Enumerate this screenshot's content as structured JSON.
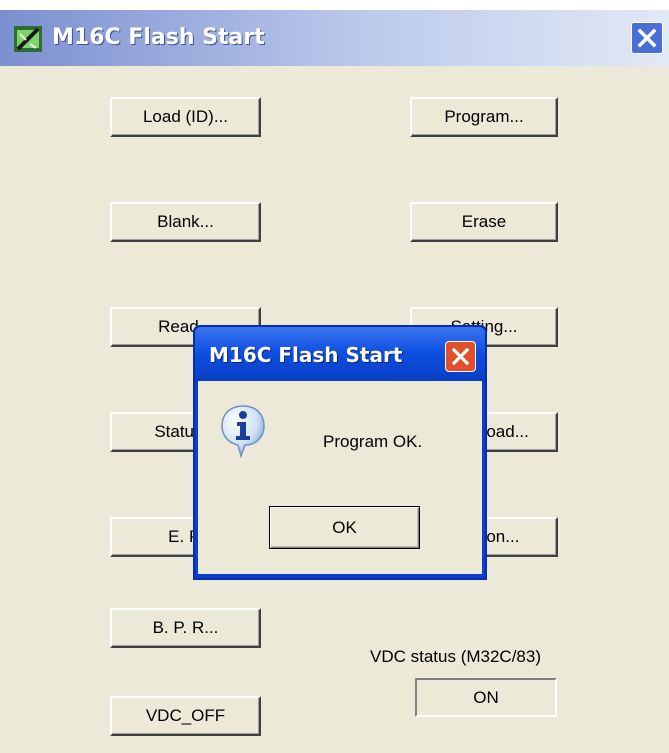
{
  "window": {
    "title": "M16C Flash Start"
  },
  "buttons": {
    "load_id": "Load (ID)...",
    "program": "Program...",
    "blank": "Blank...",
    "erase": "Erase",
    "read": "Read...",
    "setting": "Setting...",
    "status": "Status...",
    "download": "Download...",
    "ep": "E. P.",
    "version": "Version...",
    "bpr": "B. P. R...",
    "vdc_off": "VDC_OFF"
  },
  "vdc_status": {
    "label": "VDC status (M32C/83)",
    "value": "ON"
  },
  "dialog": {
    "title": "M16C Flash Start",
    "message": "Program OK.",
    "ok_label": "OK",
    "icon": "info-icon"
  },
  "colors": {
    "window_bg": "#ece9d8",
    "title_active": "#0a3fd2",
    "close_red": "#e0502c"
  }
}
